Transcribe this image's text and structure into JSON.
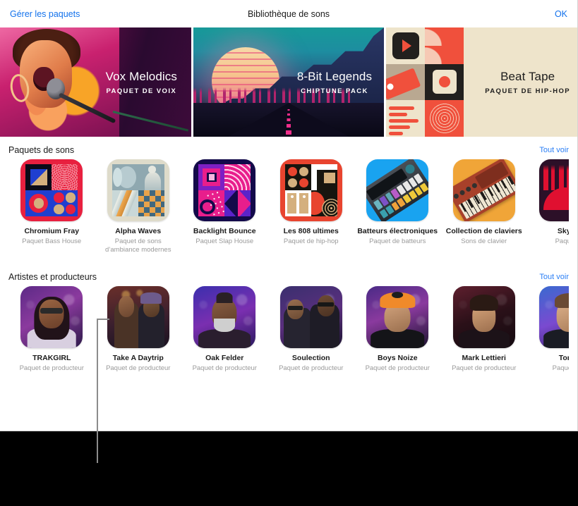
{
  "window": {
    "titlebar": {
      "manage_packs_label": "Gérer les paquets",
      "title": "Bibliothèque de sons",
      "ok_label": "OK"
    }
  },
  "featured_banners": [
    {
      "title": "Vox Melodics",
      "subtitle": "PAQUET DE VOIX",
      "theme": "light",
      "accent": "#c21878"
    },
    {
      "title": "8-Bit Legends",
      "subtitle": "CHIPTUNE PACK",
      "theme": "light",
      "accent": "#179a99"
    },
    {
      "title": "Beat Tape",
      "subtitle": "PAQUET DE HIP-HOP",
      "theme": "dark",
      "accent": "#f0503c"
    }
  ],
  "sections": [
    {
      "id": "sound-packs",
      "title": "Paquets de sons",
      "see_all_label": "Tout voir",
      "items": [
        {
          "name": "Chromium Fray",
          "subtitle": "Paquet Bass House"
        },
        {
          "name": "Alpha Waves",
          "subtitle": "Paquet de sons d’ambiance modernes"
        },
        {
          "name": "Backlight Bounce",
          "subtitle": "Paquet Slap House"
        },
        {
          "name": "Les 808 ultimes",
          "subtitle": "Paquet de hip-hop"
        },
        {
          "name": "Batteurs électroniques",
          "subtitle": "Paquet de batteurs"
        },
        {
          "name": "Collection de claviers",
          "subtitle": "Sons de clavier"
        },
        {
          "name": "Skyline",
          "subtitle": "Paquet de"
        }
      ]
    },
    {
      "id": "artists-producers",
      "title": "Artistes et producteurs",
      "see_all_label": "Tout voir",
      "items": [
        {
          "name": "TRAKGIRL",
          "subtitle": "Paquet de producteur"
        },
        {
          "name": "Take A Daytrip",
          "subtitle": "Paquet de producteur"
        },
        {
          "name": "Oak Felder",
          "subtitle": "Paquet de producteur"
        },
        {
          "name": "Soulection",
          "subtitle": "Paquet de producteur"
        },
        {
          "name": "Boys Noize",
          "subtitle": "Paquet de producteur"
        },
        {
          "name": "Mark Lettieri",
          "subtitle": "Paquet de producteur"
        },
        {
          "name": "Tom M",
          "subtitle": "Paquet de p"
        }
      ]
    }
  ],
  "colors": {
    "link_blue": "#1372ec",
    "see_all_blue": "#2b7ff5",
    "text_primary": "#1b1b1b",
    "text_secondary": "#9a9a9a",
    "panel_background": "#ffffff",
    "outside_background": "#000000",
    "callout_line": "#8c8c8c"
  }
}
